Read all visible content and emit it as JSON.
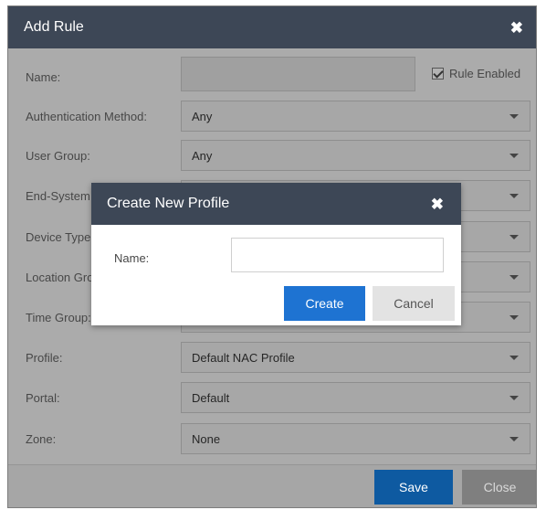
{
  "dialog": {
    "title": "Add Rule",
    "close_glyph": "✖",
    "name_label": "Name:",
    "name_value": "",
    "rule_enabled_label": "Rule Enabled",
    "rule_enabled_checked": true,
    "fields": [
      {
        "label": "Authentication Method:",
        "value": "Any"
      },
      {
        "label": "User Group:",
        "value": "Any"
      },
      {
        "label": "End-System Group:",
        "value": ""
      },
      {
        "label": "Device Type:",
        "value": ""
      },
      {
        "label": "Location Group:",
        "value": ""
      },
      {
        "label": "Time Group:",
        "value": ""
      },
      {
        "label": "Profile:",
        "value": "Default NAC Profile"
      },
      {
        "label": "Portal:",
        "value": "Default"
      },
      {
        "label": "Zone:",
        "value": "None"
      }
    ],
    "save_label": "Save",
    "close_label": "Close"
  },
  "modal": {
    "title": "Create New Profile",
    "close_glyph": "✖",
    "name_label": "Name:",
    "name_value": "",
    "create_label": "Create",
    "cancel_label": "Cancel"
  },
  "colors": {
    "header_bg": "#3d4756",
    "primary_button": "#1e73d2",
    "overlay_gray": "#ababab"
  }
}
